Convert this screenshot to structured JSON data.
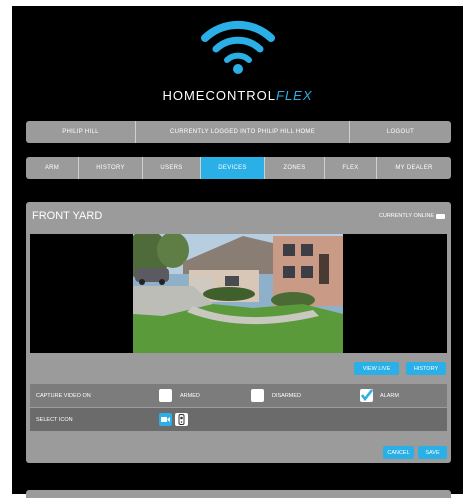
{
  "brand": {
    "name_main": "HOMECONTROL",
    "name_accent": "FLEX",
    "accent_color": "#2ab0e6"
  },
  "userbar": {
    "user": "PHILIP HILL",
    "login_status": "CURRENTLY LOGGED INTO PHILIP HILL HOME",
    "logout": "LOGOUT"
  },
  "nav": {
    "items": [
      {
        "label": "ARM"
      },
      {
        "label": "HISTORY"
      },
      {
        "label": "USERS"
      },
      {
        "label": "DEVICES",
        "active": true
      },
      {
        "label": "ZONES"
      },
      {
        "label": "FLEX"
      },
      {
        "label": "MY DEALER"
      }
    ]
  },
  "camera": {
    "title": "FRONT YARD",
    "status": "CURRENTLY ONLINE",
    "view_live": "VIEW LIVE",
    "history": "HISTORY",
    "capture_label": "CAPTURE VIDEO ON",
    "options": [
      {
        "label": "ARMED",
        "checked": false
      },
      {
        "label": "DISARMED",
        "checked": false
      },
      {
        "label": "ALARM",
        "checked": true
      }
    ],
    "select_icon_label": "SELECT ICON",
    "icons": [
      "video-camera-icon",
      "doorbell-camera-icon"
    ],
    "cancel": "CANCEL",
    "save": "SAVE"
  }
}
